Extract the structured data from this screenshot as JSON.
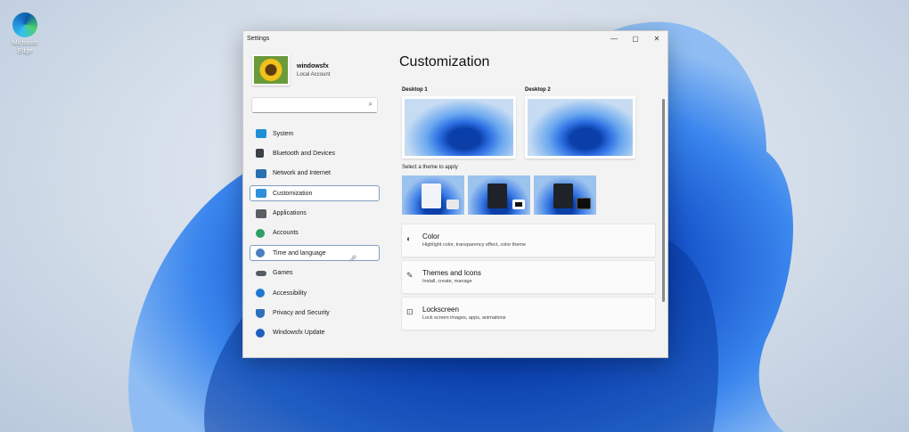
{
  "desktop": {
    "edge_label": "Microsoft Edge"
  },
  "window": {
    "title": "Settings",
    "controls": {
      "minimize": "—",
      "maximize": "▢",
      "close": "✕"
    }
  },
  "profile": {
    "name": "windowsfx",
    "account_type": "Local Account"
  },
  "search": {
    "placeholder": "",
    "icon": "search-icon"
  },
  "nav": {
    "items": [
      {
        "label": "System",
        "icon": "monitor-icon",
        "color": "#1e90d6"
      },
      {
        "label": "Bluetooth and Devices",
        "icon": "devices-icon",
        "color": "#3b3f46"
      },
      {
        "label": "Network and Internet",
        "icon": "network-icon",
        "color": "#2a6fb0"
      },
      {
        "label": "Customization",
        "icon": "customization-icon",
        "color": "#2f8fd8"
      },
      {
        "label": "Applications",
        "icon": "apps-icon",
        "color": "#5a5f66"
      },
      {
        "label": "Accounts",
        "icon": "accounts-icon",
        "color": "#2f9f66"
      },
      {
        "label": "Time and language",
        "icon": "globe-icon",
        "color": "#4a7fc0"
      },
      {
        "label": "Games",
        "icon": "gamepad-icon",
        "color": "#555b63"
      },
      {
        "label": "Accessibility",
        "icon": "accessibility-icon",
        "color": "#1f78d1"
      },
      {
        "label": "Privacy and Security",
        "icon": "shield-icon",
        "color": "#2c6fba"
      },
      {
        "label": "Windowsfx Update",
        "icon": "update-icon",
        "color": "#1f5fbf"
      }
    ],
    "active": "Customization",
    "hovered": "Time and language"
  },
  "main": {
    "title": "Customization",
    "desktops": [
      {
        "label": "Desktop 1"
      },
      {
        "label": "Desktop 2"
      }
    ],
    "themes_label": "Select a theme to apply",
    "themes": [
      {
        "name": "light",
        "window_color": "#f2f4f7",
        "badge_color": "#e9e9e9"
      },
      {
        "name": "dark",
        "window_color": "#1f2228",
        "badge_color": "#111111"
      },
      {
        "name": "dark-alt",
        "window_color": "#1f2228",
        "badge_color": "#0d0d0d"
      }
    ],
    "cards": [
      {
        "title": "Color",
        "subtitle": "Highlight color, transparency effect, color theme",
        "icon": "palette-icon"
      },
      {
        "title": "Themes and Icons",
        "subtitle": "Install, create, manage",
        "icon": "pen-icon"
      },
      {
        "title": "Lockscreen",
        "subtitle": "Lock screen images, apps, animations",
        "icon": "lock-icon"
      }
    ]
  }
}
